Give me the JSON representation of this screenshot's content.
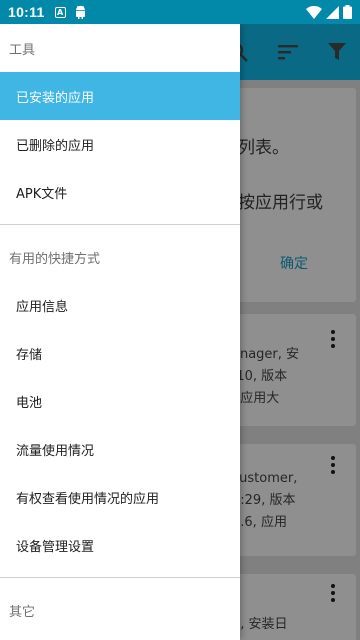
{
  "status_bar": {
    "time": "10:11",
    "a_glyph": "A"
  },
  "drawer": {
    "sections": [
      {
        "header": "工具",
        "items": [
          {
            "label": "已安装的应用",
            "selected": true
          },
          {
            "label": "已删除的应用",
            "selected": false
          },
          {
            "label": "APK文件",
            "selected": false
          }
        ]
      },
      {
        "header": "有用的快捷方式",
        "items": [
          {
            "label": "应用信息",
            "selected": false
          },
          {
            "label": "存储",
            "selected": false
          },
          {
            "label": "电池",
            "selected": false
          },
          {
            "label": "流量使用情况",
            "selected": false
          },
          {
            "label": "有权查看使用情况的应用",
            "selected": false
          },
          {
            "label": "设备管理设置",
            "selected": false
          }
        ]
      },
      {
        "header": "其它",
        "items": []
      }
    ]
  },
  "background": {
    "info_card": {
      "line1": "列表。",
      "line2": "按应用行或",
      "button": "确定"
    },
    "items": [
      {
        "lines": [
          "anager, 安",
          ":10, 版本",
          ", 应用大"
        ]
      },
      {
        "lines": [
          "customer,",
          "5:29, 版本",
          "0.6, 应用"
        ]
      },
      {
        "lines": [
          "u, 安装日"
        ]
      }
    ]
  },
  "icons": {
    "status_a": "a-notification-icon",
    "status_android": "android-icon",
    "wifi": "wifi-icon",
    "signal": "signal-icon",
    "battery": "battery-icon",
    "search": "search-icon",
    "sort": "sort-icon",
    "filter": "filter-icon",
    "overflow": "more-vert-icon"
  },
  "colors": {
    "status_bar": "#0288a8",
    "selected_item": "#3fb6e4",
    "scrim": "#808080"
  }
}
